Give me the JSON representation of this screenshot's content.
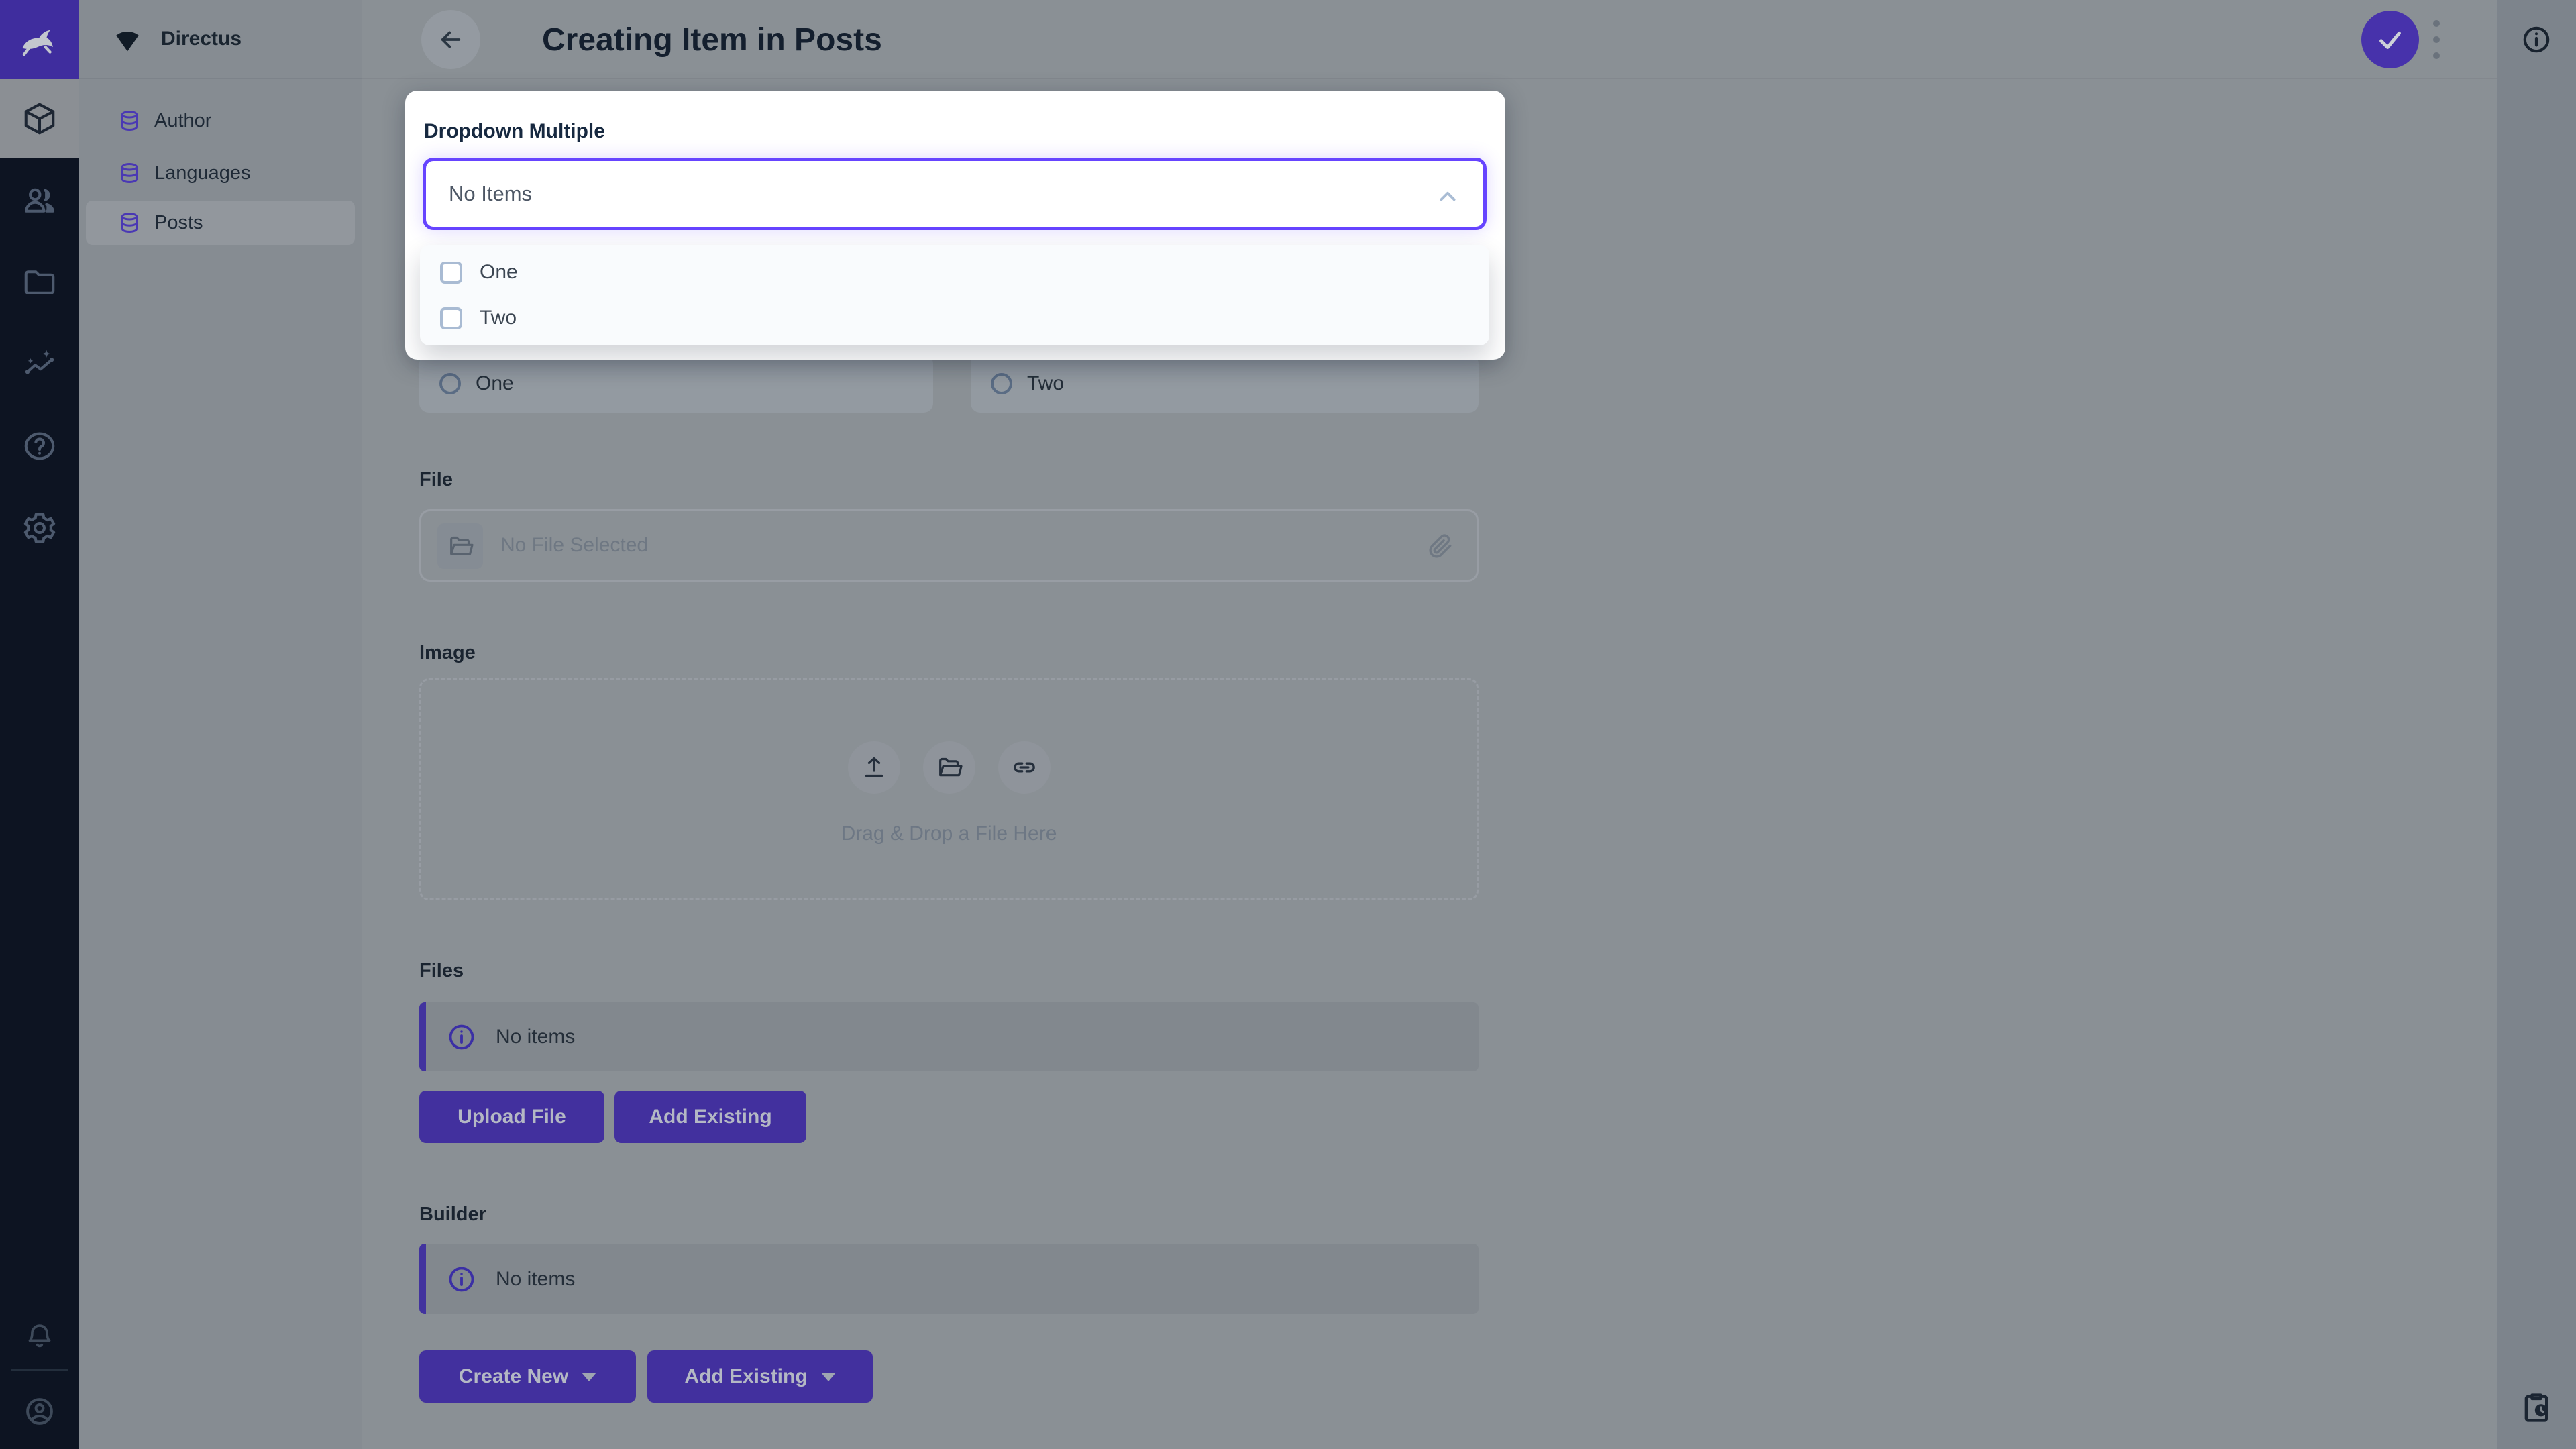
{
  "app": {
    "project_name": "Directus",
    "colors": {
      "brand_purple": "#6644ff",
      "module_bar_bg": "#0d1422",
      "logo_bg_dimmed": "#3f2d9e",
      "button_purple_dimmed": "#42309e",
      "overlay_page_gray": "#8a9095",
      "modal_bg": "#ffffff",
      "select_border": "#6644ff",
      "label_ink": "#172940"
    }
  },
  "module_bar": {
    "modules": [
      {
        "name": "content",
        "active": true
      },
      {
        "name": "user-directory",
        "active": false
      },
      {
        "name": "file-library",
        "active": false
      },
      {
        "name": "insights",
        "active": false
      },
      {
        "name": "documentation",
        "active": false
      },
      {
        "name": "settings",
        "active": false
      }
    ],
    "bottom": [
      "notifications",
      "user-menu"
    ]
  },
  "nav": {
    "project_name": "Directus",
    "items": [
      {
        "label": "Author",
        "active": false
      },
      {
        "label": "Languages",
        "active": false
      },
      {
        "label": "Posts",
        "active": true
      }
    ]
  },
  "header": {
    "title": "Creating Item in Posts"
  },
  "modal": {
    "label": "Dropdown Multiple",
    "value": "No Items",
    "options": [
      {
        "label": "One",
        "checked": false
      },
      {
        "label": "Two",
        "checked": false
      }
    ]
  },
  "form": {
    "radios": [
      {
        "label": "One",
        "selected": false
      },
      {
        "label": "Two",
        "selected": false
      }
    ],
    "file": {
      "label": "File",
      "placeholder": "No File Selected"
    },
    "image": {
      "label": "Image",
      "dropzone_text": "Drag & Drop a File Here"
    },
    "files": {
      "label": "Files",
      "empty_text": "No items",
      "buttons": [
        "Upload File",
        "Add Existing"
      ]
    },
    "builder": {
      "label": "Builder",
      "empty_text": "No items",
      "buttons": [
        "Create New",
        "Add Existing"
      ]
    }
  }
}
